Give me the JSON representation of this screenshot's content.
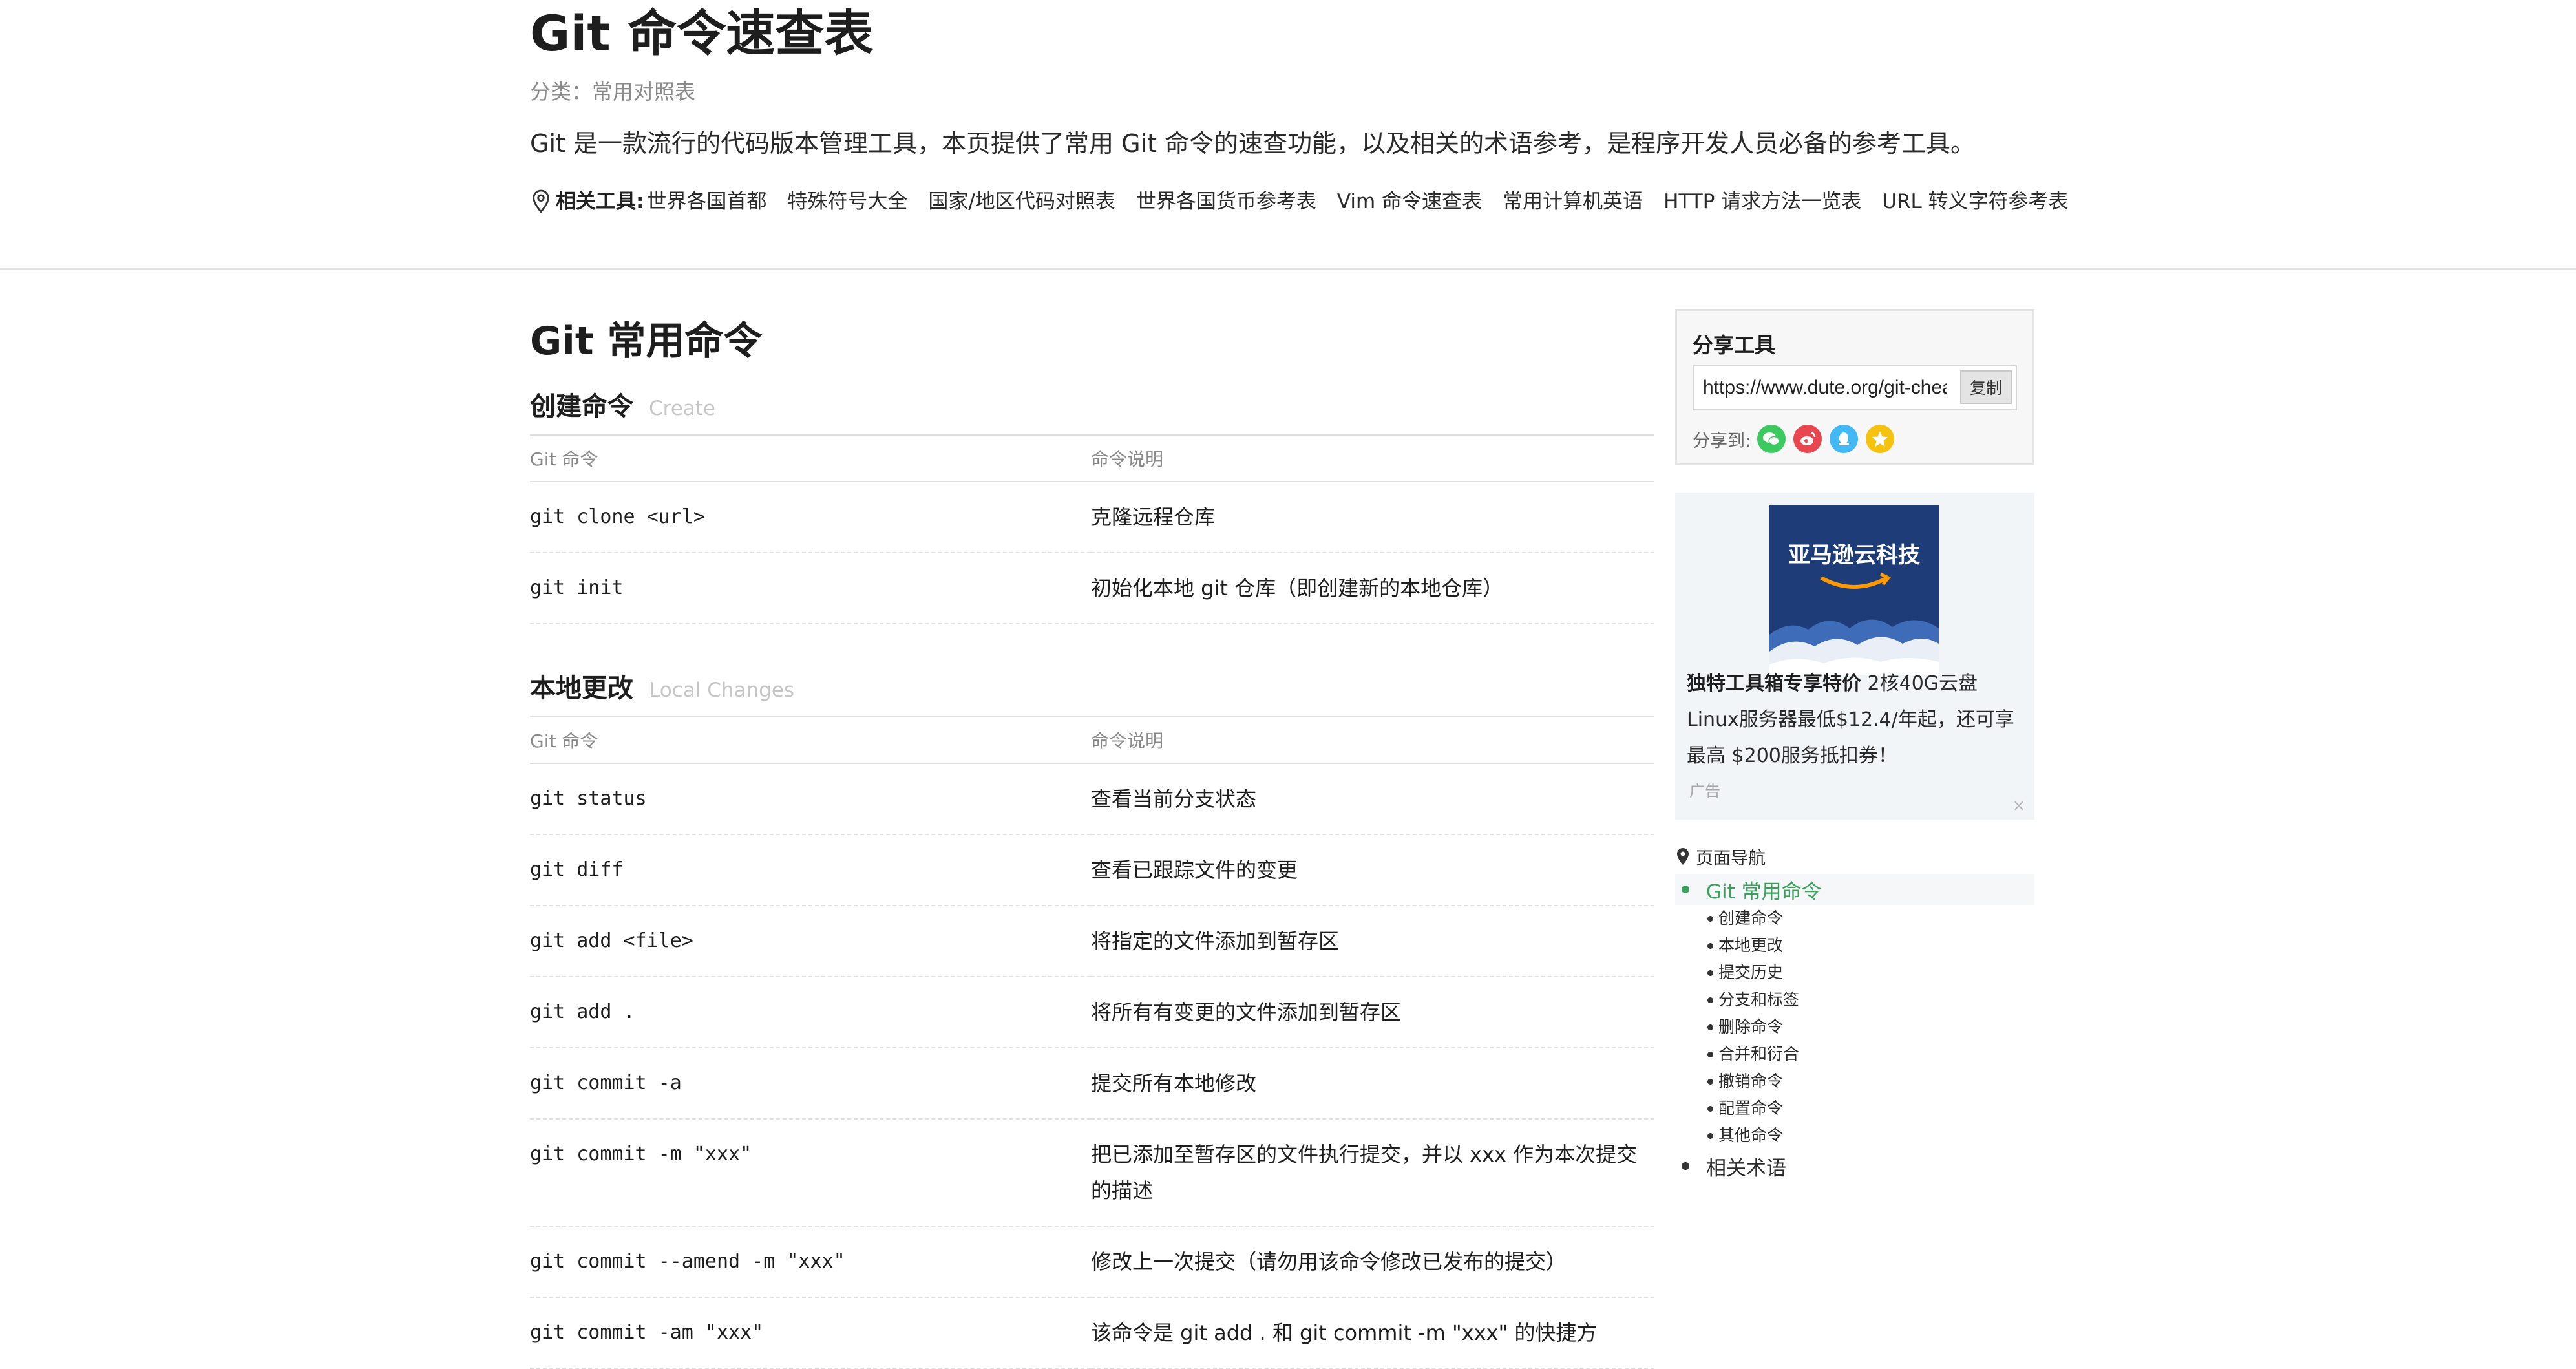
{
  "header": {
    "title": "Git 命令速查表",
    "category": "分类：常用对照表",
    "intro": "Git 是一款流行的代码版本管理工具，本页提供了常用 Git 命令的速查功能，以及相关的术语参考，是程序开发人员必备的参考工具。",
    "related_label": "相关工具:",
    "related_links": [
      "世界各国首都",
      "特殊符号大全",
      "国家/地区代码对照表",
      "世界各国货币参考表",
      "Vim 命令速查表",
      "常用计算机英语",
      "HTTP 请求方法一览表",
      "URL 转义字符参考表"
    ]
  },
  "main": {
    "section_title": "Git 常用命令",
    "col_cmd": "Git 命令",
    "col_desc": "命令说明",
    "subsections": [
      {
        "title": "创建命令",
        "title_en": "Create",
        "rows": [
          {
            "cmd": "git clone <url>",
            "desc": "克隆远程仓库"
          },
          {
            "cmd": "git init",
            "desc": "初始化本地 git 仓库（即创建新的本地仓库）"
          }
        ]
      },
      {
        "title": "本地更改",
        "title_en": "Local Changes",
        "rows": [
          {
            "cmd": "git status",
            "desc": "查看当前分支状态"
          },
          {
            "cmd": "git diff",
            "desc": "查看已跟踪文件的变更"
          },
          {
            "cmd": "git add <file>",
            "desc": "将指定的文件添加到暂存区"
          },
          {
            "cmd": "git add .",
            "desc": "将所有有变更的文件添加到暂存区"
          },
          {
            "cmd": "git commit -a",
            "desc": "提交所有本地修改"
          },
          {
            "cmd": "git commit -m \"xxx\"",
            "desc": "把已添加至暂存区的文件执行提交，并以 xxx 作为本次提交的描述"
          },
          {
            "cmd": "git commit --amend -m \"xxx\"",
            "desc": "修改上一次提交（请勿用该命令修改已发布的提交）"
          },
          {
            "cmd": "git commit -am \"xxx\"",
            "desc": "该命令是 git add . 和 git commit -m \"xxx\" 的快捷方"
          }
        ]
      }
    ]
  },
  "sidebar": {
    "share": {
      "title": "分享工具",
      "url": "https://www.dute.org/git-cheat-sheet",
      "copy_label": "复制",
      "share_to_label": "分享到:",
      "targets": [
        {
          "icon": "wechat-icon",
          "color": "#3cc95f"
        },
        {
          "icon": "weibo-icon",
          "color": "#e8474f"
        },
        {
          "icon": "qq-icon",
          "color": "#42b9f5"
        },
        {
          "icon": "qzone-icon",
          "color": "#f4c20f"
        }
      ]
    },
    "ad": {
      "image_text": "亚马逊云科技",
      "bold": "独特工具箱专享特价",
      "text": " 2核40G云盘Linux服务器最低$12.4/年起，还可享最高 $200服务抵扣券！",
      "tag": "广告",
      "close": "×"
    },
    "toc": {
      "title": "页面导航",
      "active": "Git 常用命令",
      "sub_items": [
        "创建命令",
        "本地更改",
        "提交历史",
        "分支和标签",
        "删除命令",
        "合并和衍合",
        "撤销命令",
        "配置命令",
        "其他命令"
      ],
      "last_item": "相关术语"
    }
  },
  "colors": {
    "accent_green": "#3aa05b",
    "ad_background": "#f2f5f8",
    "ad_navy": "#1d3c78"
  }
}
